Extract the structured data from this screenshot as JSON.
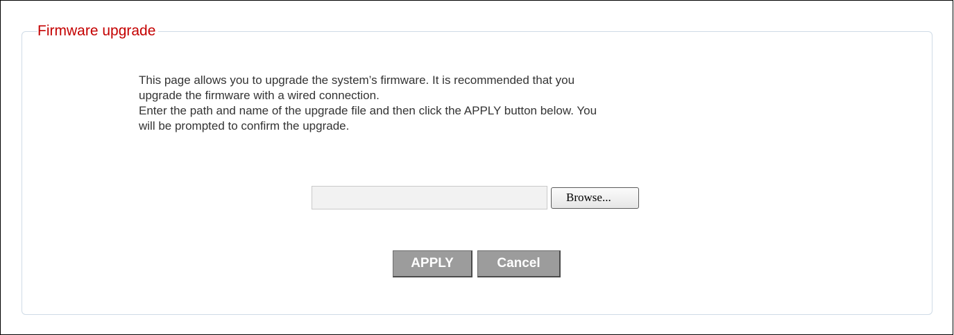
{
  "section": {
    "title": "Firmware upgrade"
  },
  "description": {
    "line1": "This page allows you to upgrade the system’s firmware. It is recommended that you",
    "line2": "upgrade the firmware with a wired connection.",
    "line3": "Enter the path and name of the upgrade file and then click the APPLY button below. You",
    "line4": "will be prompted to confirm the upgrade."
  },
  "file_input": {
    "value": "",
    "placeholder": "",
    "browse_label": "Browse..."
  },
  "actions": {
    "apply_label": "APPLY",
    "cancel_label": "Cancel"
  },
  "colors": {
    "title": "#c40000",
    "panel_border": "#cfdbe6",
    "button_bg": "#9c9c9c",
    "button_text": "#ffffff"
  }
}
